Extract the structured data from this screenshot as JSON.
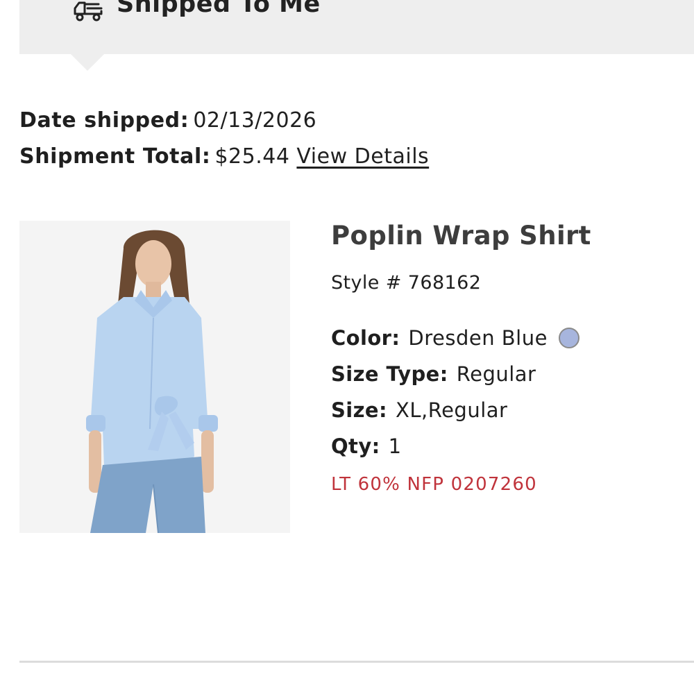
{
  "banner": {
    "title": "Shipped To Me",
    "icon": "truck-icon"
  },
  "shipment": {
    "date_label": "Date shipped:",
    "date_value": "02/13/2026",
    "total_label": "Shipment Total:",
    "total_value": "$25.44",
    "view_details_label": "View Details"
  },
  "product": {
    "name": "Poplin Wrap Shirt",
    "style": "Style # 768162",
    "color_label": "Color:",
    "color_value": "Dresden Blue",
    "color_swatch_hex": "#a7b5dd",
    "size_type_label": "Size Type:",
    "size_type_value": "Regular",
    "size_label": "Size:",
    "size_value": "XL,Regular",
    "qty_label": "Qty:",
    "qty_value": "1",
    "promo_code": "LT 60% NFP 0207260",
    "promo_color": "#c0333b"
  },
  "colors": {
    "banner_bg": "#eeeeee",
    "text": "#1f1f1f",
    "divider": "#dcdcdc"
  }
}
